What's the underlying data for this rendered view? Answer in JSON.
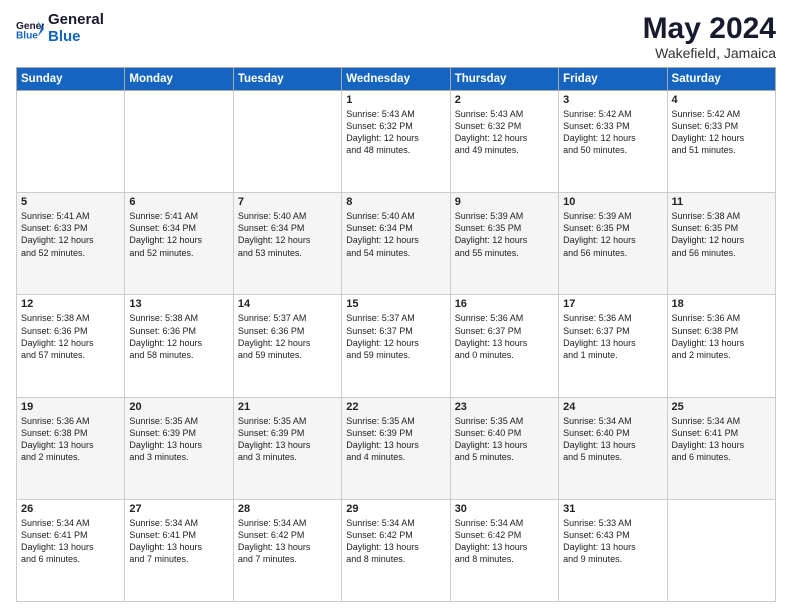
{
  "logo": {
    "line1": "General",
    "line2": "Blue"
  },
  "header": {
    "month_year": "May 2024",
    "location": "Wakefield, Jamaica"
  },
  "weekdays": [
    "Sunday",
    "Monday",
    "Tuesday",
    "Wednesday",
    "Thursday",
    "Friday",
    "Saturday"
  ],
  "weeks": [
    [
      {
        "day": "",
        "text": ""
      },
      {
        "day": "",
        "text": ""
      },
      {
        "day": "",
        "text": ""
      },
      {
        "day": "1",
        "text": "Sunrise: 5:43 AM\nSunset: 6:32 PM\nDaylight: 12 hours\nand 48 minutes."
      },
      {
        "day": "2",
        "text": "Sunrise: 5:43 AM\nSunset: 6:32 PM\nDaylight: 12 hours\nand 49 minutes."
      },
      {
        "day": "3",
        "text": "Sunrise: 5:42 AM\nSunset: 6:33 PM\nDaylight: 12 hours\nand 50 minutes."
      },
      {
        "day": "4",
        "text": "Sunrise: 5:42 AM\nSunset: 6:33 PM\nDaylight: 12 hours\nand 51 minutes."
      }
    ],
    [
      {
        "day": "5",
        "text": "Sunrise: 5:41 AM\nSunset: 6:33 PM\nDaylight: 12 hours\nand 52 minutes."
      },
      {
        "day": "6",
        "text": "Sunrise: 5:41 AM\nSunset: 6:34 PM\nDaylight: 12 hours\nand 52 minutes."
      },
      {
        "day": "7",
        "text": "Sunrise: 5:40 AM\nSunset: 6:34 PM\nDaylight: 12 hours\nand 53 minutes."
      },
      {
        "day": "8",
        "text": "Sunrise: 5:40 AM\nSunset: 6:34 PM\nDaylight: 12 hours\nand 54 minutes."
      },
      {
        "day": "9",
        "text": "Sunrise: 5:39 AM\nSunset: 6:35 PM\nDaylight: 12 hours\nand 55 minutes."
      },
      {
        "day": "10",
        "text": "Sunrise: 5:39 AM\nSunset: 6:35 PM\nDaylight: 12 hours\nand 56 minutes."
      },
      {
        "day": "11",
        "text": "Sunrise: 5:38 AM\nSunset: 6:35 PM\nDaylight: 12 hours\nand 56 minutes."
      }
    ],
    [
      {
        "day": "12",
        "text": "Sunrise: 5:38 AM\nSunset: 6:36 PM\nDaylight: 12 hours\nand 57 minutes."
      },
      {
        "day": "13",
        "text": "Sunrise: 5:38 AM\nSunset: 6:36 PM\nDaylight: 12 hours\nand 58 minutes."
      },
      {
        "day": "14",
        "text": "Sunrise: 5:37 AM\nSunset: 6:36 PM\nDaylight: 12 hours\nand 59 minutes."
      },
      {
        "day": "15",
        "text": "Sunrise: 5:37 AM\nSunset: 6:37 PM\nDaylight: 12 hours\nand 59 minutes."
      },
      {
        "day": "16",
        "text": "Sunrise: 5:36 AM\nSunset: 6:37 PM\nDaylight: 13 hours\nand 0 minutes."
      },
      {
        "day": "17",
        "text": "Sunrise: 5:36 AM\nSunset: 6:37 PM\nDaylight: 13 hours\nand 1 minute."
      },
      {
        "day": "18",
        "text": "Sunrise: 5:36 AM\nSunset: 6:38 PM\nDaylight: 13 hours\nand 2 minutes."
      }
    ],
    [
      {
        "day": "19",
        "text": "Sunrise: 5:36 AM\nSunset: 6:38 PM\nDaylight: 13 hours\nand 2 minutes."
      },
      {
        "day": "20",
        "text": "Sunrise: 5:35 AM\nSunset: 6:39 PM\nDaylight: 13 hours\nand 3 minutes."
      },
      {
        "day": "21",
        "text": "Sunrise: 5:35 AM\nSunset: 6:39 PM\nDaylight: 13 hours\nand 3 minutes."
      },
      {
        "day": "22",
        "text": "Sunrise: 5:35 AM\nSunset: 6:39 PM\nDaylight: 13 hours\nand 4 minutes."
      },
      {
        "day": "23",
        "text": "Sunrise: 5:35 AM\nSunset: 6:40 PM\nDaylight: 13 hours\nand 5 minutes."
      },
      {
        "day": "24",
        "text": "Sunrise: 5:34 AM\nSunset: 6:40 PM\nDaylight: 13 hours\nand 5 minutes."
      },
      {
        "day": "25",
        "text": "Sunrise: 5:34 AM\nSunset: 6:41 PM\nDaylight: 13 hours\nand 6 minutes."
      }
    ],
    [
      {
        "day": "26",
        "text": "Sunrise: 5:34 AM\nSunset: 6:41 PM\nDaylight: 13 hours\nand 6 minutes."
      },
      {
        "day": "27",
        "text": "Sunrise: 5:34 AM\nSunset: 6:41 PM\nDaylight: 13 hours\nand 7 minutes."
      },
      {
        "day": "28",
        "text": "Sunrise: 5:34 AM\nSunset: 6:42 PM\nDaylight: 13 hours\nand 7 minutes."
      },
      {
        "day": "29",
        "text": "Sunrise: 5:34 AM\nSunset: 6:42 PM\nDaylight: 13 hours\nand 8 minutes."
      },
      {
        "day": "30",
        "text": "Sunrise: 5:34 AM\nSunset: 6:42 PM\nDaylight: 13 hours\nand 8 minutes."
      },
      {
        "day": "31",
        "text": "Sunrise: 5:33 AM\nSunset: 6:43 PM\nDaylight: 13 hours\nand 9 minutes."
      },
      {
        "day": "",
        "text": ""
      }
    ]
  ]
}
